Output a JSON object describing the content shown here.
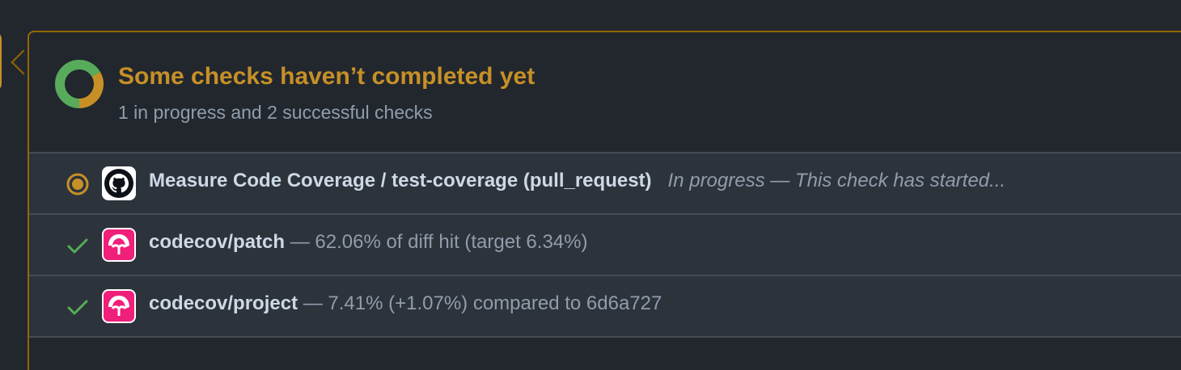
{
  "merge_box": {
    "title": "Some checks haven’t completed yet",
    "subtitle": "1 in progress and 2 successful checks",
    "colors": {
      "pending": "#c69026",
      "success": "#57ab5a",
      "border": "#966600",
      "background": "#22272e",
      "row_background": "#2d333b"
    },
    "status_summary": {
      "in_progress": 1,
      "successful": 2
    }
  },
  "checks": [
    {
      "status": "in-progress",
      "status_icon": "in-progress-dot-icon",
      "app_icon": "github-logo-icon",
      "name": "Measure Code Coverage / test-coverage (pull_request)",
      "description": "In progress — This check has started..."
    },
    {
      "status": "success",
      "status_icon": "check-icon",
      "app_icon": "codecov-logo-icon",
      "name": "codecov/patch",
      "description": " — 62.06% of diff hit (target 6.34%)"
    },
    {
      "status": "success",
      "status_icon": "check-icon",
      "app_icon": "codecov-logo-icon",
      "name": "codecov/project",
      "description": " — 7.41% (+1.07%) compared to 6d6a727"
    }
  ]
}
